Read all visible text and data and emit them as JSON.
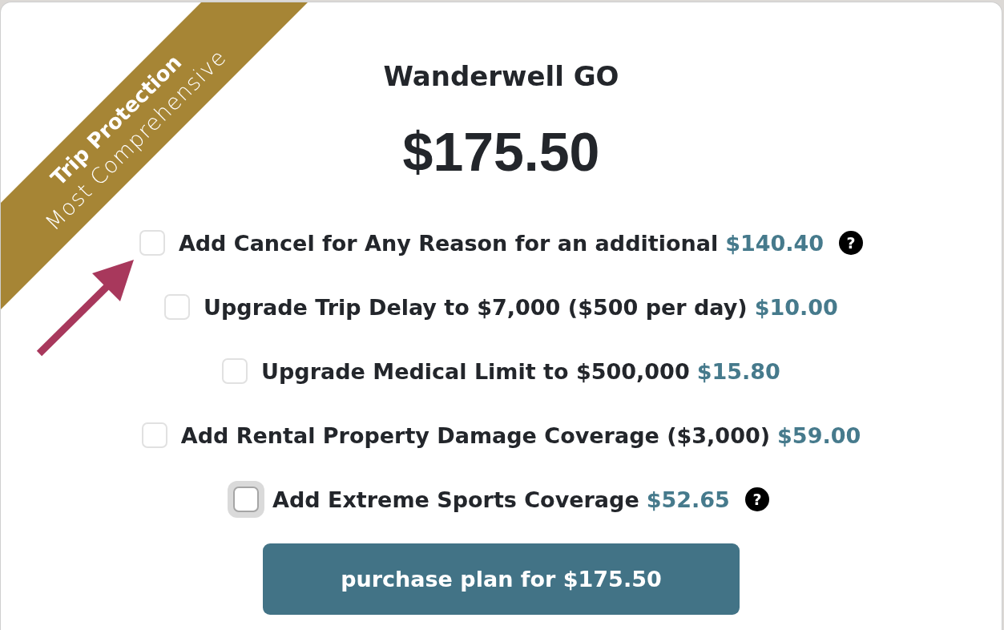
{
  "ribbon": {
    "title": "Trip Protection",
    "subtitle": "Most Comprehensive"
  },
  "plan": {
    "name": "Wanderwell GO",
    "price": "$175.50"
  },
  "options": [
    {
      "label": "Add Cancel for Any Reason for an additional",
      "price": "$140.40",
      "help": "?",
      "checked": false,
      "focused": false
    },
    {
      "label": "Upgrade Trip Delay to $7,000 ($500 per day)",
      "price": "$10.00",
      "checked": false,
      "focused": false
    },
    {
      "label": "Upgrade Medical Limit to $500,000",
      "price": "$15.80",
      "checked": false,
      "focused": false
    },
    {
      "label": "Add Rental Property Damage Coverage ($3,000)",
      "price": "$59.00",
      "checked": false,
      "focused": false
    },
    {
      "label": "Add Extreme Sports Coverage",
      "price": "$52.65",
      "help": "?",
      "checked": false,
      "focused": true
    }
  ],
  "purchase_button": {
    "label": "purchase plan for $175.50"
  }
}
